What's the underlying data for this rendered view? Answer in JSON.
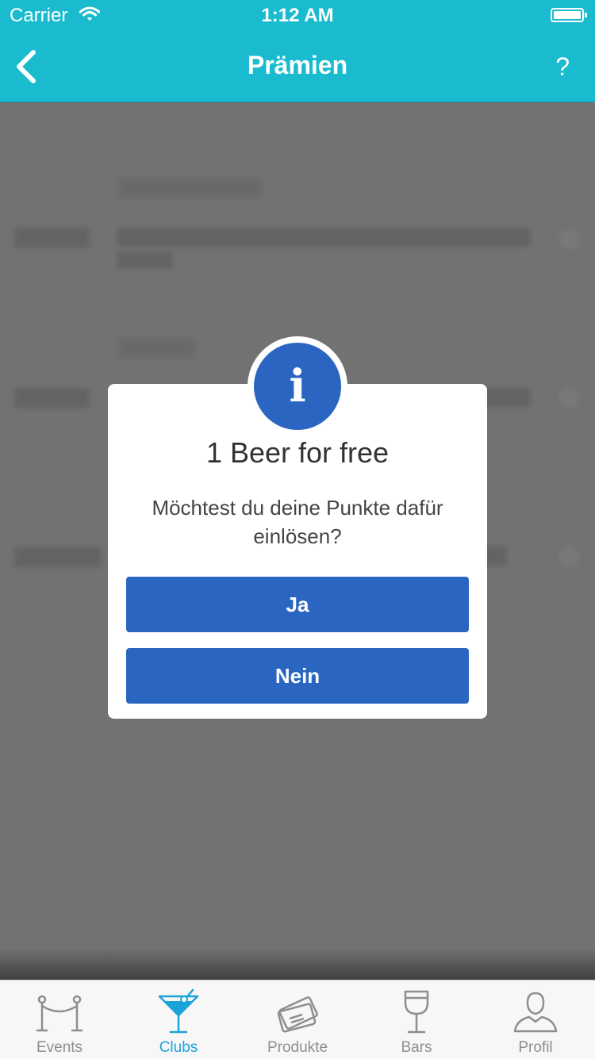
{
  "status_bar": {
    "carrier": "Carrier",
    "time": "1:12 AM"
  },
  "nav": {
    "title": "Prämien",
    "help": "?"
  },
  "dialog": {
    "icon_glyph": "i",
    "title": "1 Beer for free",
    "message": "Möchtest du deine Punkte dafür einlösen?",
    "yes_label": "Ja",
    "no_label": "Nein"
  },
  "tabs": [
    {
      "label": "Events",
      "icon": "rope-barrier-icon",
      "active": false
    },
    {
      "label": "Clubs",
      "icon": "cocktail-icon",
      "active": true
    },
    {
      "label": "Produkte",
      "icon": "tickets-icon",
      "active": false
    },
    {
      "label": "Bars",
      "icon": "wine-glass-icon",
      "active": false
    },
    {
      "label": "Profil",
      "icon": "person-icon",
      "active": false
    }
  ],
  "colors": {
    "header": "#1bbbcf",
    "accent": "#2a66c1",
    "tab_active": "#1aa3d6"
  }
}
